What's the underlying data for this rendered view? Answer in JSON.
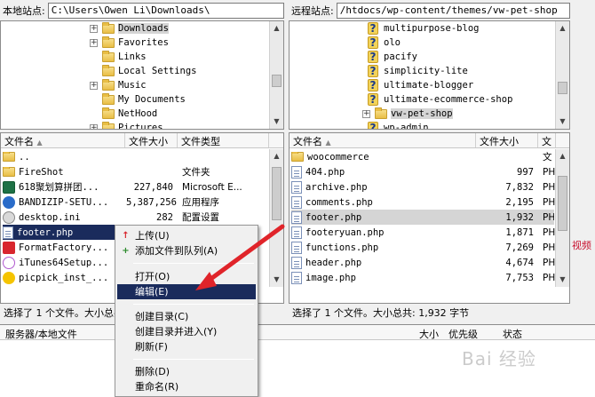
{
  "local_site": {
    "label": "本地站点:",
    "path": "C:\\Users\\Owen Li\\Downloads\\",
    "tree": [
      {
        "label": "Downloads",
        "expander": "+",
        "selected": true
      },
      {
        "label": "Favorites",
        "expander": "+"
      },
      {
        "label": "Links",
        "expander": ""
      },
      {
        "label": "Local Settings",
        "expander": ""
      },
      {
        "label": "Music",
        "expander": "+"
      },
      {
        "label": "My Documents",
        "expander": ""
      },
      {
        "label": "NetHood",
        "expander": ""
      },
      {
        "label": "Pictures",
        "expander": "+"
      }
    ]
  },
  "remote_site": {
    "label": "远程站点:",
    "path": "/htdocs/wp-content/themes/vw-pet-shop",
    "tree": [
      {
        "label": "multipurpose-blog",
        "icon": "question"
      },
      {
        "label": "olo",
        "icon": "question"
      },
      {
        "label": "pacify",
        "icon": "question"
      },
      {
        "label": "simplicity-lite",
        "icon": "question"
      },
      {
        "label": "ultimate-blogger",
        "icon": "question"
      },
      {
        "label": "ultimate-ecommerce-shop",
        "icon": "question"
      },
      {
        "label": "vw-pet-shop",
        "icon": "folder",
        "expander": "+",
        "selected": true
      },
      {
        "label": "wp-admin",
        "icon": "question"
      }
    ]
  },
  "local_list": {
    "headers": {
      "name": "文件名",
      "size": "文件大小",
      "type": "文件类型"
    },
    "rows": [
      {
        "name": "..",
        "size": "",
        "type": "",
        "icon": "folder"
      },
      {
        "name": "FireShot",
        "size": "",
        "type": "文件夹",
        "icon": "folder"
      },
      {
        "name": "618聚划算拼团...",
        "size": "227,840",
        "type": "Microsoft E...",
        "icon": "excel"
      },
      {
        "name": "BANDIZIP-SETU...",
        "size": "5,387,256",
        "type": "应用程序",
        "icon": "app-blue"
      },
      {
        "name": "desktop.ini",
        "size": "282",
        "type": "配置设置",
        "icon": "gear"
      },
      {
        "name": "footer.php",
        "size": "",
        "type": "",
        "icon": "file",
        "selected": true
      },
      {
        "name": "FormatFactory...",
        "size": "",
        "type": "",
        "icon": "app-red"
      },
      {
        "name": "iTunes64Setup...",
        "size": "",
        "type": "",
        "icon": "app-itunes"
      },
      {
        "name": "picpick_inst_...",
        "size": "",
        "type": "",
        "icon": "app-yellow"
      }
    ],
    "status": "选择了 1 个文件。大小总共: 1,932 字节"
  },
  "remote_list": {
    "headers": {
      "name": "文件名",
      "size": "文件大小",
      "type": "文"
    },
    "rows": [
      {
        "name": "woocommerce",
        "size": "",
        "type": "文",
        "icon": "folder"
      },
      {
        "name": "404.php",
        "size": "997",
        "type": "PH",
        "icon": "file"
      },
      {
        "name": "archive.php",
        "size": "7,832",
        "type": "PH",
        "icon": "file"
      },
      {
        "name": "comments.php",
        "size": "2,195",
        "type": "PH",
        "icon": "file"
      },
      {
        "name": "footer.php",
        "size": "1,932",
        "type": "PH",
        "icon": "file",
        "selected": true
      },
      {
        "name": "footeryuan.php",
        "size": "1,871",
        "type": "PH",
        "icon": "file"
      },
      {
        "name": "functions.php",
        "size": "7,269",
        "type": "PH",
        "icon": "file"
      },
      {
        "name": "header.php",
        "size": "4,674",
        "type": "PH",
        "icon": "file"
      },
      {
        "name": "image.php",
        "size": "7,753",
        "type": "PH",
        "icon": "file"
      }
    ],
    "status": "选择了 1 个文件。大小总共: 1,932 字节"
  },
  "queue": {
    "col_server": "服务器/本地文件",
    "col_size": "大小",
    "col_priority": "优先级",
    "col_status": "状态"
  },
  "context_menu": {
    "items": [
      {
        "label": "上传(U)",
        "icon": "upload-arrow"
      },
      {
        "label": "添加文件到队列(A)",
        "icon": "add-queue"
      },
      {
        "label": "打开(O)"
      },
      {
        "label": "编辑(E)",
        "highlighted": true
      },
      {
        "label": "创建目录(C)"
      },
      {
        "label": "创建目录并进入(Y)"
      },
      {
        "label": "刷新(F)"
      },
      {
        "label": "删除(D)"
      },
      {
        "label": "重命名(R)"
      }
    ]
  },
  "side_text": "视频",
  "watermark": "Bai 经验",
  "colors": {
    "highlight": "#1a2b5c",
    "arrow": "#e0242a",
    "selection": "#d5d5d5"
  }
}
